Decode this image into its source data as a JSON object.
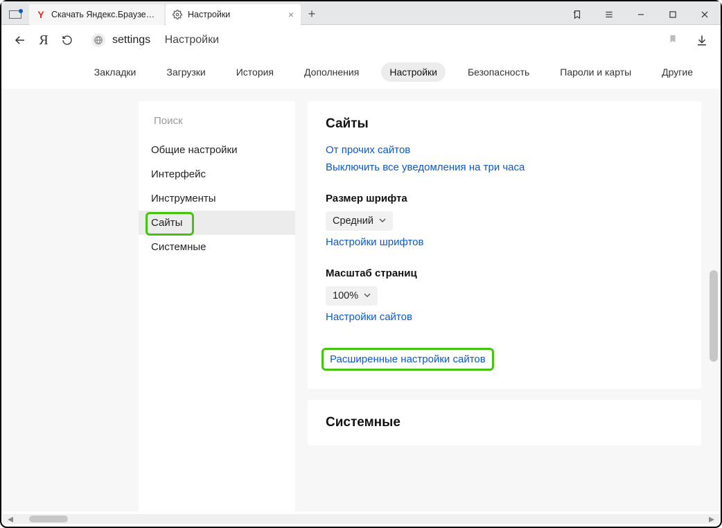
{
  "titlebar": {
    "tabs": [
      {
        "label": "Скачать Яндекс.Браузер д",
        "favicon": "y"
      },
      {
        "label": "Настройки",
        "favicon": "gear"
      }
    ],
    "newtab": "+"
  },
  "address": {
    "slug": "settings",
    "page": "Настройки"
  },
  "topnav": {
    "items": [
      "Закладки",
      "Загрузки",
      "История",
      "Дополнения",
      "Настройки",
      "Безопасность",
      "Пароли и карты",
      "Другие"
    ],
    "active_index": 4
  },
  "sidebar": {
    "search_placeholder": "Поиск",
    "items": [
      "Общие настройки",
      "Интерфейс",
      "Инструменты",
      "Сайты",
      "Системные"
    ],
    "active_index": 3
  },
  "sites_card": {
    "title": "Сайты",
    "link_other": "От прочих сайтов",
    "link_mute": "Выключить все уведомления на три часа",
    "font_heading": "Размер шрифта",
    "font_value": "Средний",
    "font_link": "Настройки шрифтов",
    "scale_heading": "Масштаб страниц",
    "scale_value": "100%",
    "scale_link": "Настройки сайтов",
    "advanced_link": "Расширенные настройки сайтов"
  },
  "system_card": {
    "title": "Системные"
  }
}
